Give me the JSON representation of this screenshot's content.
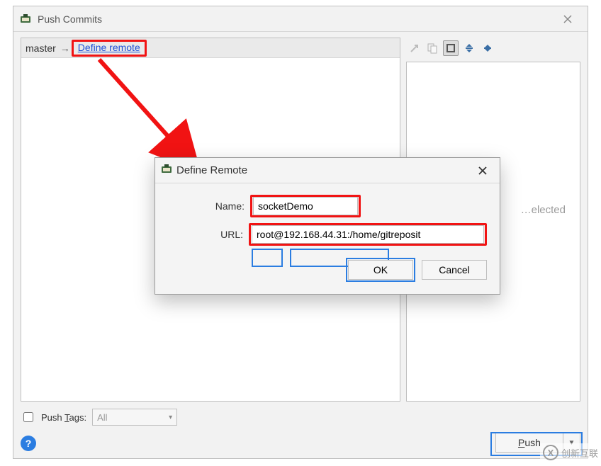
{
  "pushCommits": {
    "title": "Push Commits",
    "branch_name": "master",
    "branch_arrow": "→",
    "define_remote_label": "Define remote",
    "side_placeholder": "…elected",
    "push_tags_prefix": "Push ",
    "push_tags_letter": "T",
    "push_tags_suffix": "ags:",
    "push_tags_combo_text": "All",
    "push_button_letter": "P",
    "push_button_suffix": "ush",
    "help_label": "?",
    "toolbar": {
      "newCommit": "new-commit-icon",
      "duplicate": "duplicate-icon",
      "wrap": "soft-wrap-icon",
      "expand": "expand-icon",
      "collapse": "collapse-icon"
    }
  },
  "defineRemote": {
    "title": "Define Remote",
    "name_label": "Name:",
    "name_value": "socketDemo",
    "url_label": "URL:",
    "url_value": "root@192.168.44.31:/home/gitreposit",
    "ok_label": "OK",
    "cancel_label": "Cancel"
  },
  "watermark": {
    "text": "创新互联"
  }
}
